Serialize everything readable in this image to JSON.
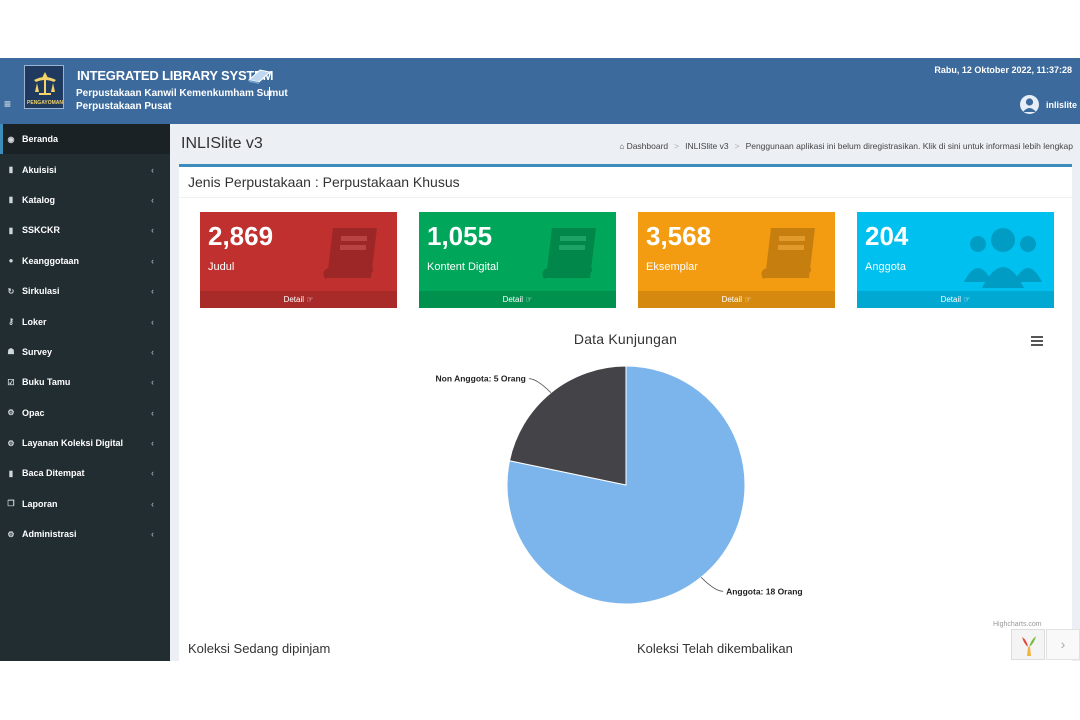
{
  "header": {
    "system_title": "INTEGRATED LIBRARY SYSTEM",
    "logo_caption": "PENGAYOMAN",
    "institution_line1": "Perpustakaan Kanwil Kemenkumham Sumut",
    "institution_line2": "Perpustakaan Pusat",
    "datetime": "Rabu, 12 Oktober 2022, 11:37:28",
    "user_name": "inlislite",
    "menu_icon": "hamburger-icon"
  },
  "sidebar": {
    "items": [
      {
        "label": "Beranda",
        "icon": "dashboard-icon",
        "glyph": "◉",
        "active": true,
        "has_children": false
      },
      {
        "label": "Akuisisi",
        "icon": "book-icon",
        "glyph": "▮",
        "has_children": true
      },
      {
        "label": "Katalog",
        "icon": "book-icon",
        "glyph": "▮",
        "has_children": true
      },
      {
        "label": "SSKCKR",
        "icon": "book-icon",
        "glyph": "▮",
        "has_children": true
      },
      {
        "label": "Keanggotaan",
        "icon": "user-icon",
        "glyph": "●",
        "has_children": true
      },
      {
        "label": "Sirkulasi",
        "icon": "refresh-icon",
        "glyph": "↻",
        "has_children": true
      },
      {
        "label": "Loker",
        "icon": "key-icon",
        "glyph": "⚷",
        "has_children": true
      },
      {
        "label": "Survey",
        "icon": "users-icon",
        "glyph": "☗",
        "has_children": true
      },
      {
        "label": "Buku Tamu",
        "icon": "check-square-icon",
        "glyph": "☑",
        "has_children": true
      },
      {
        "label": "Opac",
        "icon": "cogs-icon",
        "glyph": "⚙",
        "has_children": true
      },
      {
        "label": "Layanan Koleksi Digital",
        "icon": "cogs-icon",
        "glyph": "⚙",
        "has_children": true
      },
      {
        "label": "Baca Ditempat",
        "icon": "book-icon",
        "glyph": "▮",
        "has_children": true
      },
      {
        "label": "Laporan",
        "icon": "copy-icon",
        "glyph": "❐",
        "has_children": true
      },
      {
        "label": "Administrasi",
        "icon": "cogs-icon",
        "glyph": "⚙",
        "has_children": true
      }
    ],
    "chevron": "‹"
  },
  "content": {
    "page_title": "INLISlite v3",
    "breadcrumb": {
      "home_label": "Dashboard",
      "current": "INLISlite v3",
      "notice": "Penggunaan aplikasi ini belum diregistrasikan. Klik di sini untuk informasi lebih lengkap"
    },
    "box_title": "Jenis Perpustakaan : Perpustakaan Khusus",
    "stats": [
      {
        "value": "2,869",
        "label": "Judul",
        "footer": "Detail",
        "color": "#c0302f",
        "icon": "book-icon"
      },
      {
        "value": "1,055",
        "label": "Kontent Digital",
        "footer": "Detail",
        "color": "#00a65a",
        "icon": "book-icon"
      },
      {
        "value": "3,568",
        "label": "Eksemplar",
        "footer": "Detail",
        "color": "#f39c12",
        "icon": "book-icon"
      },
      {
        "value": "204",
        "label": "Anggota",
        "footer": "Detail",
        "color": "#00c0ef",
        "icon": "users-icon"
      }
    ],
    "footer_icon": "hand-pointer-icon",
    "koleksi_pinjam": "Koleksi Sedang dipinjam",
    "koleksi_kembali": "Koleksi Telah dikembalikan"
  },
  "chart_data": {
    "type": "pie",
    "title": "Data Kunjungan",
    "credit": "Highcharts.com",
    "slices": [
      {
        "name": "Anggota",
        "value": 18,
        "label": "Anggota: 18 Orang",
        "color": "#7cb5ec"
      },
      {
        "name": "Non Anggota",
        "value": 5,
        "label": "Non Anggota: 5 Orang",
        "color": "#434348"
      }
    ]
  }
}
